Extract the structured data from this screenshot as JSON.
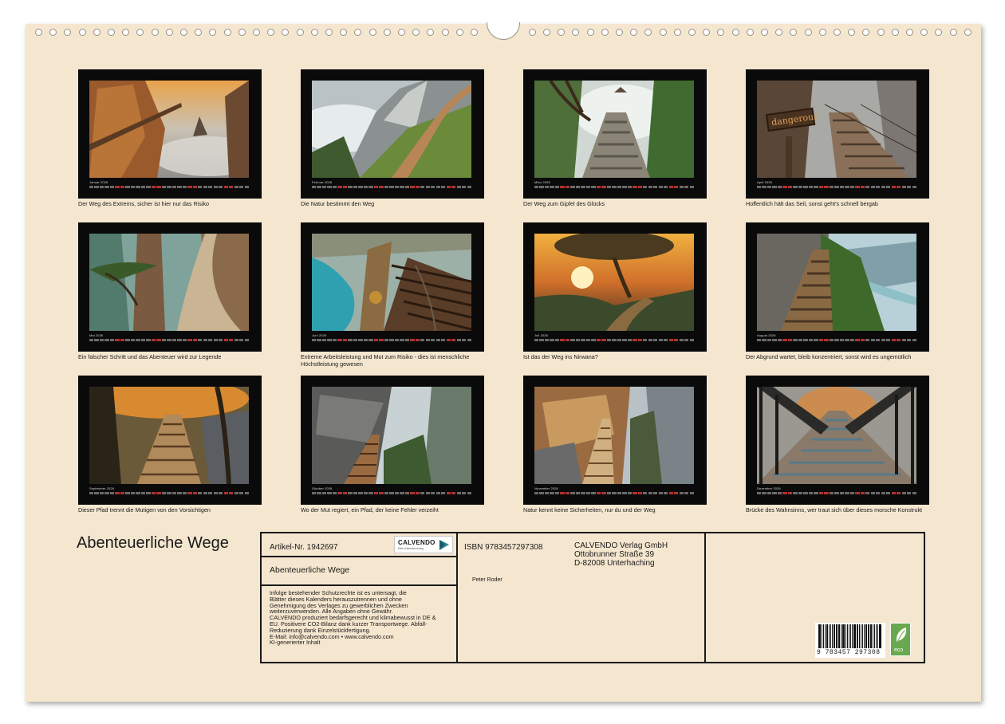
{
  "calendar": {
    "title": "Abenteuerliche Wege",
    "months": [
      {
        "label": "Januar 2026",
        "caption": "Der Weg des Extrems, sicher ist hier nur das Risiko"
      },
      {
        "label": "Februar 2026",
        "caption": "Die Natur bestimmt den Weg"
      },
      {
        "label": "März 2026",
        "caption": "Der Weg zum Gipfel des Glücks"
      },
      {
        "label": "April 2026",
        "caption": "Hoffentlich hält das Seil, sonst geht's schnell bergab",
        "sign": "dangerous"
      },
      {
        "label": "Mai 2026",
        "caption": "Ein falscher Schritt und das Abenteuer wird zur Legende"
      },
      {
        "label": "Juni 2026",
        "caption": "Extreme Arbeitsleistung und Mut zum Risiko - dies ist menschliche Höchstleistung gewesen"
      },
      {
        "label": "Juli 2026",
        "caption": "Ist das der Weg ins Nirwana?"
      },
      {
        "label": "August 2026",
        "caption": "Der Abgrund wartet, bleib konzentriert, sonst wird es ungemütlich"
      },
      {
        "label": "September 2026",
        "caption": "Dieser Pfad trennt die Mutigen von den Vorsichtigen"
      },
      {
        "label": "Oktober 2026",
        "caption": "Wo der Mut regiert, ein Pfad, der keine Fehler verzeiht"
      },
      {
        "label": "November 2026",
        "caption": "Natur kennt keine Sicherheiten, nur du und der Weg"
      },
      {
        "label": "Dezember 2026",
        "caption": "Brücke des Wahnsinns, wer traut sich über dieses morsche Konstrukt"
      }
    ]
  },
  "info": {
    "article": "Artikel-Nr. 1942697",
    "logo_name": "CALVENDO",
    "logo_sub": "Dein Kalenderverlag",
    "product_title": "Abenteuerliche Wege",
    "legal": [
      "Infolge bestehender Schutzrechte ist es untersagt, die",
      "Blätter dieses Kalenders herauszutrennen und ohne",
      "Genehmigung des Verlages zu gewerblichen Zwecken",
      "weiterzuverwenden. Alle Angaben ohne Gewähr.",
      "CALVENDO produziert bedarfsgerecht und klimabewusst in DE &",
      "EU. Positivere CO2-Bilanz dank kurzer Transportwege. Abfall-",
      "Reduzierung dank Einzelstückfertigung.",
      "E-Mail: info@calvendo.com • www.calvendo.com",
      "KI-generierter Inhalt"
    ],
    "isbn": "ISBN 9783457297308",
    "publisher": [
      "CALVENDO Verlag GmbH",
      "Ottobrunner Straße 39",
      "D-82008 Unterhaching"
    ],
    "author": "Peter Roder",
    "barcode_number": "9 783457 297308",
    "eco_label": "eco"
  },
  "colors": {
    "paper": "#f5e6cf",
    "frame": "#0a0a0a",
    "eco_green": "#6aa84f"
  }
}
